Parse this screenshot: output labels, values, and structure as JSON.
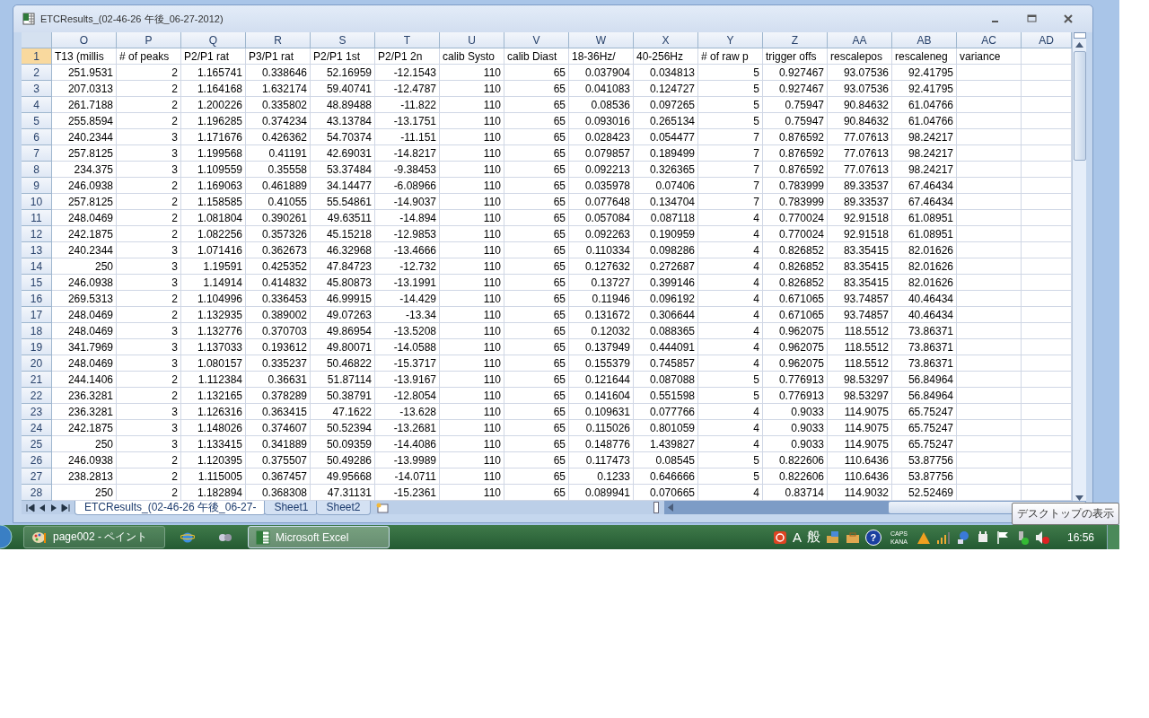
{
  "window": {
    "title": "ETCResults_(02-46-26 午後_06-27-2012)"
  },
  "columns": [
    "O",
    "P",
    "Q",
    "R",
    "S",
    "T",
    "U",
    "V",
    "W",
    "X",
    "Y",
    "Z",
    "AA",
    "AB",
    "AC",
    "AD"
  ],
  "rows": [
    {
      "number": "1",
      "selected": true,
      "kind": "text",
      "cells": [
        "T13 (millis",
        "# of peaks",
        "P2/P1 rat",
        "P3/P1 rat",
        "P2/P1 1st",
        "P2/P1 2n",
        "calib Systo",
        "calib Diast",
        "18-36Hz/",
        "40-256Hz",
        "# of raw p",
        "trigger offs",
        "rescalepos",
        "rescaleneg",
        "variance"
      ]
    },
    {
      "number": "2",
      "selected": false,
      "kind": "number",
      "cells": [
        "251.9531",
        "2",
        "1.165741",
        "0.338646",
        "52.16959",
        "-12.1543",
        "110",
        "65",
        "0.037904",
        "0.034813",
        "5",
        "0.927467",
        "93.07536",
        "92.41795"
      ]
    },
    {
      "number": "3",
      "selected": false,
      "kind": "number",
      "cells": [
        "207.0313",
        "2",
        "1.164168",
        "1.632174",
        "59.40741",
        "-12.4787",
        "110",
        "65",
        "0.041083",
        "0.124727",
        "5",
        "0.927467",
        "93.07536",
        "92.41795"
      ]
    },
    {
      "number": "4",
      "selected": false,
      "kind": "number",
      "cells": [
        "261.7188",
        "2",
        "1.200226",
        "0.335802",
        "48.89488",
        "-11.822",
        "110",
        "65",
        "0.08536",
        "0.097265",
        "5",
        "0.75947",
        "90.84632",
        "61.04766"
      ]
    },
    {
      "number": "5",
      "selected": false,
      "kind": "number",
      "cells": [
        "255.8594",
        "2",
        "1.196285",
        "0.374234",
        "43.13784",
        "-13.1751",
        "110",
        "65",
        "0.093016",
        "0.265134",
        "5",
        "0.75947",
        "90.84632",
        "61.04766"
      ]
    },
    {
      "number": "6",
      "selected": false,
      "kind": "number",
      "cells": [
        "240.2344",
        "3",
        "1.171676",
        "0.426362",
        "54.70374",
        "-11.151",
        "110",
        "65",
        "0.028423",
        "0.054477",
        "7",
        "0.876592",
        "77.07613",
        "98.24217"
      ]
    },
    {
      "number": "7",
      "selected": false,
      "kind": "number",
      "cells": [
        "257.8125",
        "3",
        "1.199568",
        "0.41191",
        "42.69031",
        "-14.8217",
        "110",
        "65",
        "0.079857",
        "0.189499",
        "7",
        "0.876592",
        "77.07613",
        "98.24217"
      ]
    },
    {
      "number": "8",
      "selected": false,
      "kind": "number",
      "cells": [
        "234.375",
        "3",
        "1.109559",
        "0.35558",
        "53.37484",
        "-9.38453",
        "110",
        "65",
        "0.092213",
        "0.326365",
        "7",
        "0.876592",
        "77.07613",
        "98.24217"
      ]
    },
    {
      "number": "9",
      "selected": false,
      "kind": "number",
      "cells": [
        "246.0938",
        "2",
        "1.169063",
        "0.461889",
        "34.14477",
        "-6.08966",
        "110",
        "65",
        "0.035978",
        "0.07406",
        "7",
        "0.783999",
        "89.33537",
        "67.46434"
      ]
    },
    {
      "number": "10",
      "selected": false,
      "kind": "number",
      "cells": [
        "257.8125",
        "2",
        "1.158585",
        "0.41055",
        "55.54861",
        "-14.9037",
        "110",
        "65",
        "0.077648",
        "0.134704",
        "7",
        "0.783999",
        "89.33537",
        "67.46434"
      ]
    },
    {
      "number": "11",
      "selected": false,
      "kind": "number",
      "cells": [
        "248.0469",
        "2",
        "1.081804",
        "0.390261",
        "49.63511",
        "-14.894",
        "110",
        "65",
        "0.057084",
        "0.087118",
        "4",
        "0.770024",
        "92.91518",
        "61.08951"
      ]
    },
    {
      "number": "12",
      "selected": false,
      "kind": "number",
      "cells": [
        "242.1875",
        "2",
        "1.082256",
        "0.357326",
        "45.15218",
        "-12.9853",
        "110",
        "65",
        "0.092263",
        "0.190959",
        "4",
        "0.770024",
        "92.91518",
        "61.08951"
      ]
    },
    {
      "number": "13",
      "selected": false,
      "kind": "number",
      "cells": [
        "240.2344",
        "3",
        "1.071416",
        "0.362673",
        "46.32968",
        "-13.4666",
        "110",
        "65",
        "0.110334",
        "0.098286",
        "4",
        "0.826852",
        "83.35415",
        "82.01626"
      ]
    },
    {
      "number": "14",
      "selected": false,
      "kind": "number",
      "cells": [
        "250",
        "3",
        "1.19591",
        "0.425352",
        "47.84723",
        "-12.732",
        "110",
        "65",
        "0.127632",
        "0.272687",
        "4",
        "0.826852",
        "83.35415",
        "82.01626"
      ]
    },
    {
      "number": "15",
      "selected": false,
      "kind": "number",
      "cells": [
        "246.0938",
        "3",
        "1.14914",
        "0.414832",
        "45.80873",
        "-13.1991",
        "110",
        "65",
        "0.13727",
        "0.399146",
        "4",
        "0.826852",
        "83.35415",
        "82.01626"
      ]
    },
    {
      "number": "16",
      "selected": false,
      "kind": "number",
      "cells": [
        "269.5313",
        "2",
        "1.104996",
        "0.336453",
        "46.99915",
        "-14.429",
        "110",
        "65",
        "0.11946",
        "0.096192",
        "4",
        "0.671065",
        "93.74857",
        "40.46434"
      ]
    },
    {
      "number": "17",
      "selected": false,
      "kind": "number",
      "cells": [
        "248.0469",
        "2",
        "1.132935",
        "0.389002",
        "49.07263",
        "-13.34",
        "110",
        "65",
        "0.131672",
        "0.306644",
        "4",
        "0.671065",
        "93.74857",
        "40.46434"
      ]
    },
    {
      "number": "18",
      "selected": false,
      "kind": "number",
      "cells": [
        "248.0469",
        "3",
        "1.132776",
        "0.370703",
        "49.86954",
        "-13.5208",
        "110",
        "65",
        "0.12032",
        "0.088365",
        "4",
        "0.962075",
        "118.5512",
        "73.86371"
      ]
    },
    {
      "number": "19",
      "selected": false,
      "kind": "number",
      "cells": [
        "341.7969",
        "3",
        "1.137033",
        "0.193612",
        "49.80071",
        "-14.0588",
        "110",
        "65",
        "0.137949",
        "0.444091",
        "4",
        "0.962075",
        "118.5512",
        "73.86371"
      ]
    },
    {
      "number": "20",
      "selected": false,
      "kind": "number",
      "cells": [
        "248.0469",
        "3",
        "1.080157",
        "0.335237",
        "50.46822",
        "-15.3717",
        "110",
        "65",
        "0.155379",
        "0.745857",
        "4",
        "0.962075",
        "118.5512",
        "73.86371"
      ]
    },
    {
      "number": "21",
      "selected": false,
      "kind": "number",
      "cells": [
        "244.1406",
        "2",
        "1.112384",
        "0.36631",
        "51.87114",
        "-13.9167",
        "110",
        "65",
        "0.121644",
        "0.087088",
        "5",
        "0.776913",
        "98.53297",
        "56.84964"
      ]
    },
    {
      "number": "22",
      "selected": false,
      "kind": "number",
      "cells": [
        "236.3281",
        "2",
        "1.132165",
        "0.378289",
        "50.38791",
        "-12.8054",
        "110",
        "65",
        "0.141604",
        "0.551598",
        "5",
        "0.776913",
        "98.53297",
        "56.84964"
      ]
    },
    {
      "number": "23",
      "selected": false,
      "kind": "number",
      "cells": [
        "236.3281",
        "3",
        "1.126316",
        "0.363415",
        "47.1622",
        "-13.628",
        "110",
        "65",
        "0.109631",
        "0.077766",
        "4",
        "0.9033",
        "114.9075",
        "65.75247"
      ]
    },
    {
      "number": "24",
      "selected": false,
      "kind": "number",
      "cells": [
        "242.1875",
        "3",
        "1.148026",
        "0.374607",
        "50.52394",
        "-13.2681",
        "110",
        "65",
        "0.115026",
        "0.801059",
        "4",
        "0.9033",
        "114.9075",
        "65.75247"
      ]
    },
    {
      "number": "25",
      "selected": false,
      "kind": "number",
      "cells": [
        "250",
        "3",
        "1.133415",
        "0.341889",
        "50.09359",
        "-14.4086",
        "110",
        "65",
        "0.148776",
        "1.439827",
        "4",
        "0.9033",
        "114.9075",
        "65.75247"
      ]
    },
    {
      "number": "26",
      "selected": false,
      "kind": "number",
      "cells": [
        "246.0938",
        "2",
        "1.120395",
        "0.375507",
        "50.49286",
        "-13.9989",
        "110",
        "65",
        "0.117473",
        "0.08545",
        "5",
        "0.822606",
        "110.6436",
        "53.87756"
      ]
    },
    {
      "number": "27",
      "selected": false,
      "kind": "number",
      "cells": [
        "238.2813",
        "2",
        "1.115005",
        "0.367457",
        "49.95668",
        "-14.0711",
        "110",
        "65",
        "0.1233",
        "0.646666",
        "5",
        "0.822606",
        "110.6436",
        "53.87756"
      ]
    },
    {
      "number": "28",
      "selected": false,
      "kind": "number",
      "cells": [
        "250",
        "2",
        "1.182894",
        "0.368308",
        "47.31131",
        "-15.2361",
        "110",
        "65",
        "0.089941",
        "0.070665",
        "4",
        "0.83714",
        "114.9032",
        "52.52469"
      ]
    }
  ],
  "sheet_tabs": [
    {
      "label": "ETCResults_(02-46-26 午後_06-27-",
      "selected": true
    },
    {
      "label": "Sheet1",
      "selected": false
    },
    {
      "label": "Sheet2",
      "selected": false
    }
  ],
  "taskbar": {
    "buttons": [
      {
        "kind": "paint",
        "label": "page002 - ペイント",
        "selected": false
      },
      {
        "kind": "browser",
        "selected": false
      },
      {
        "kind": "app",
        "selected": false
      },
      {
        "kind": "excel",
        "label": "Microsoft Excel",
        "selected": true
      }
    ],
    "ime": [
      "A",
      "般"
    ],
    "help": "?",
    "caps": "CAPS",
    "kana": "KANA",
    "clock": "16:56"
  },
  "tooltip": "デスクトップの表示"
}
